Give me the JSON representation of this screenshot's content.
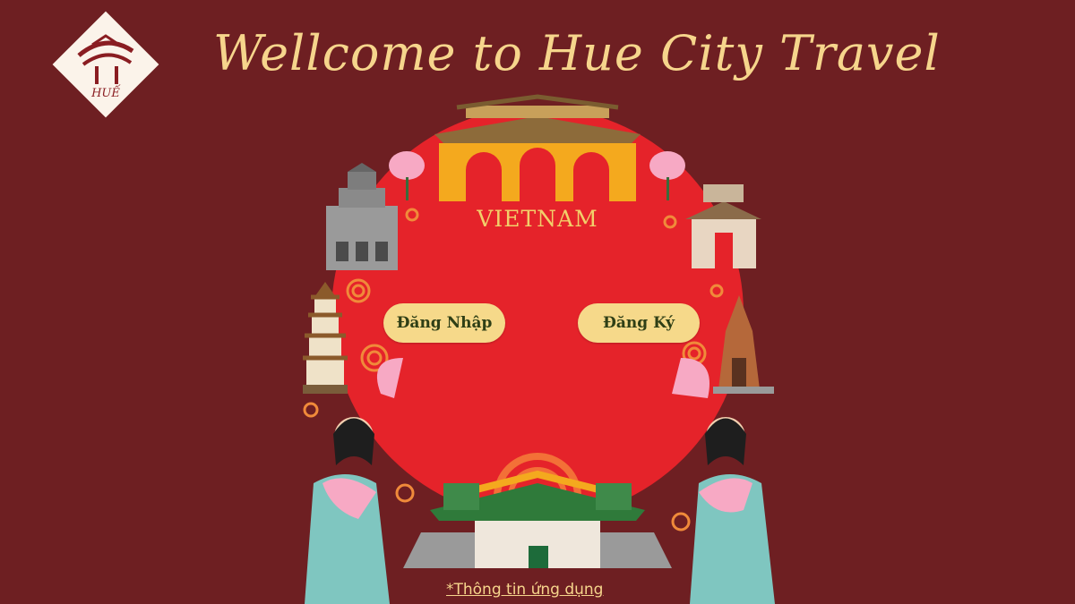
{
  "header": {
    "title": "Wellcome to Hue City Travel",
    "logo_text": "HUẾ",
    "logo_icon": "hue-logo-icon"
  },
  "hero": {
    "badge_text": "VIETNAM"
  },
  "auth": {
    "login_label": "Đăng Nhập",
    "register_label": "Đăng Ký"
  },
  "footer": {
    "app_info_link": "*Thông tin ứng dụng"
  },
  "colors": {
    "background": "#6e1f22",
    "circle": "#e5232a",
    "title": "#f6d58c",
    "button": "#f6d98a",
    "button_text": "#2f3f16"
  }
}
